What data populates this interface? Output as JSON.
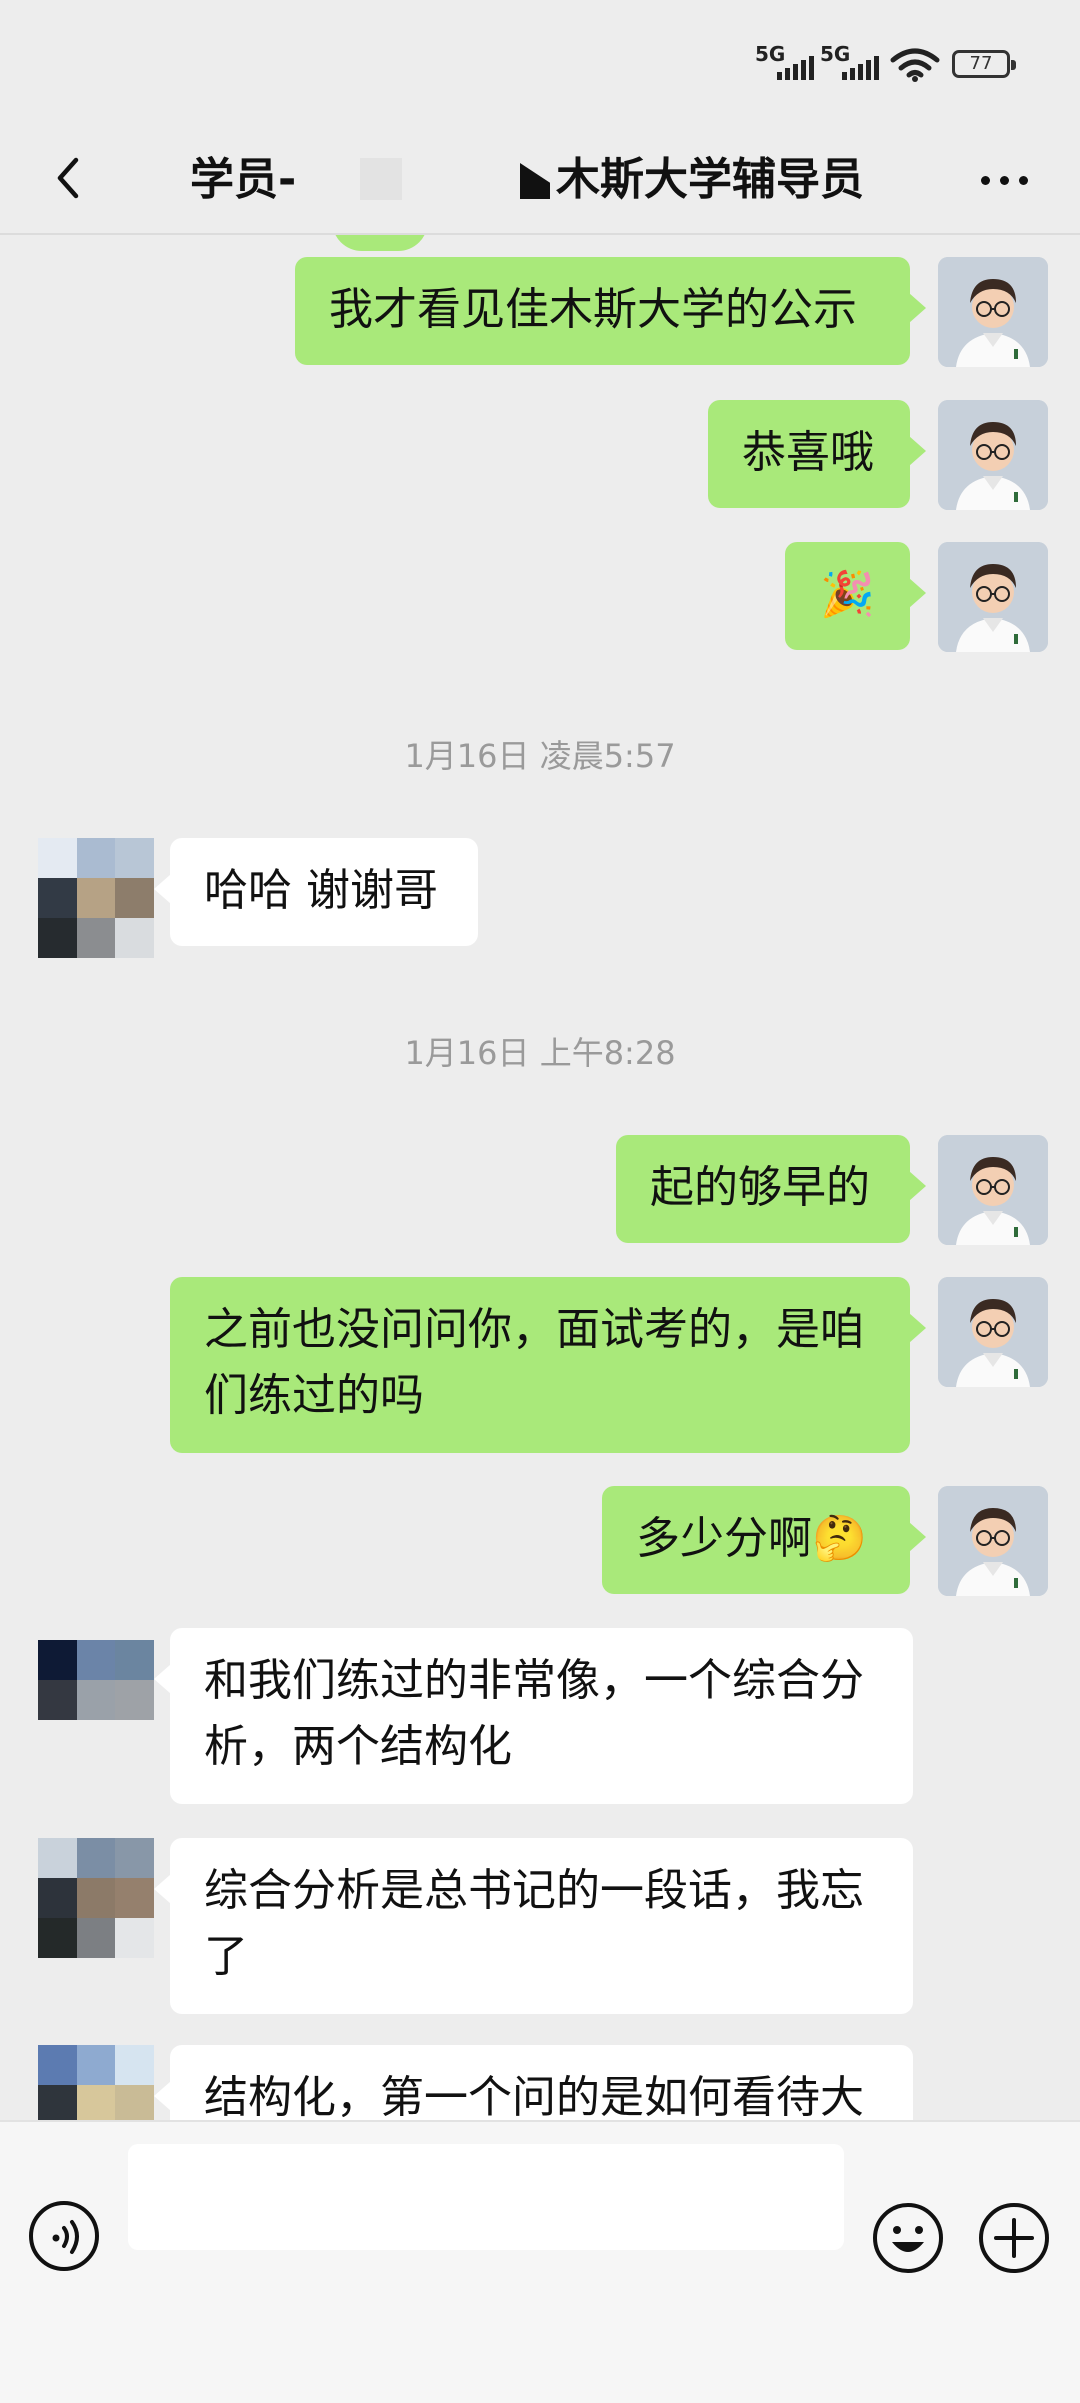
{
  "status_bar": {
    "sim1": "5G",
    "sim2": "5G",
    "battery": "77"
  },
  "header": {
    "title_left": "学员-",
    "title_right": "木斯大学辅导员"
  },
  "messages": [
    {
      "from": "me",
      "text": "我才看见佳木斯大学的公示"
    },
    {
      "from": "me",
      "text": "恭喜哦"
    },
    {
      "from": "me",
      "text": "🎉"
    },
    {
      "timestamp": "1月16日 凌晨5:57"
    },
    {
      "from": "them",
      "text": "哈哈 谢谢哥"
    },
    {
      "timestamp": "1月16日 上午8:28"
    },
    {
      "from": "me",
      "text": "起的够早的"
    },
    {
      "from": "me",
      "text": "之前也没问问你，面试考的，是咱们练过的吗"
    },
    {
      "from": "me",
      "text": "多少分啊🤔"
    },
    {
      "from": "them",
      "text": "和我们练过的非常像，一个综合分析，两个结构化"
    },
    {
      "from": "them",
      "text": "综合分析是总书记的一段话，我忘了"
    },
    {
      "from": "them",
      "text": "结构化，第一个问的是如何看待大"
    }
  ],
  "input_bar": {
    "placeholder": ""
  },
  "icons": {
    "back": "chevron-left-icon",
    "more": "more-dots-icon",
    "voice": "voice-icon",
    "emoji": "emoji-icon",
    "plus": "plus-icon"
  },
  "colors": {
    "sent_bubble": "#a9e97a",
    "received_bubble": "#ffffff",
    "background": "#ededed"
  }
}
